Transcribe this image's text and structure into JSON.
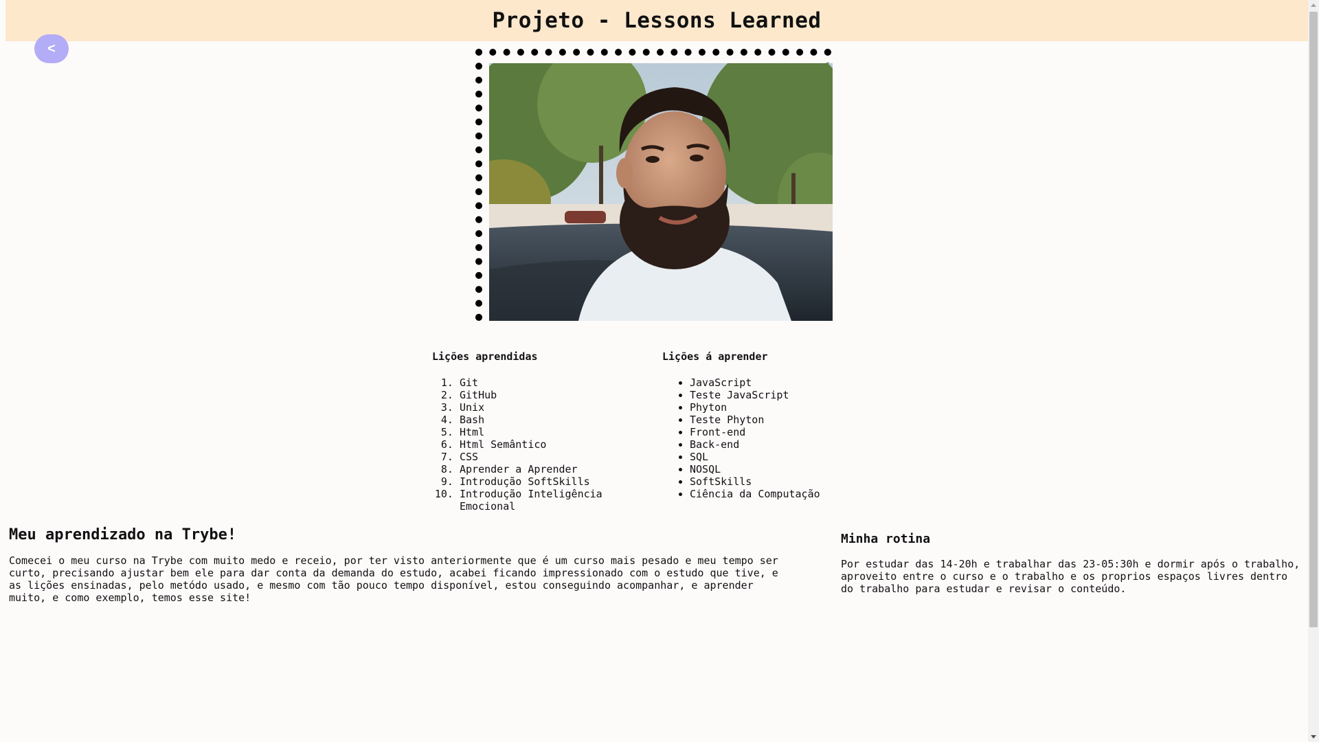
{
  "header": {
    "title": "Projeto - Lessons Learned",
    "background_color": "#fde8cc"
  },
  "back_button": {
    "label": "<",
    "color": "#b3acf6"
  },
  "profile_photo": {
    "subject": "portrait of a bearded man in a white t-shirt, trees in background"
  },
  "lessons_learned": {
    "title": "Lições aprendidas",
    "items": [
      "Git",
      "GitHub",
      "Unix",
      "Bash",
      "Html",
      "Html Semântico",
      "CSS",
      "Aprender a Aprender",
      "Introdução SoftSkills",
      "Introdução Inteligência Emocional"
    ]
  },
  "lessons_to_learn": {
    "title": "Lições á aprender",
    "items": [
      "JavaScript",
      "Teste JavaScript",
      "Phyton",
      "Teste Phyton",
      "Front-end",
      "Back-end",
      "SQL",
      "NOSQL",
      "SoftSkills",
      "Ciência da Computação"
    ]
  },
  "trybe_section": {
    "title": "Meu aprendizado na Trybe!",
    "text": "Comecei o meu curso na Trybe com muito medo e receio, por ter visto anteriormente que é um curso mais pesado e meu tempo ser curto, precisando ajustar bem ele para dar conta da demanda do estudo, acabei ficando impressionado com o estudo que tive, e as lições ensinadas, pelo metódo usado, e mesmo com tão pouco tempo disponível, estou conseguindo acompanhar, e aprender muito, e como exemplo, temos esse site!"
  },
  "routine_section": {
    "title": "Minha rotina",
    "text": "Por estudar das 14-20h e trabalhar das 23-05:30h e dormir após o trabalho, aproveito entre o curso e o trabalho e os proprios espaços livres dentro do trabalho para estudar e revisar o conteúdo."
  }
}
